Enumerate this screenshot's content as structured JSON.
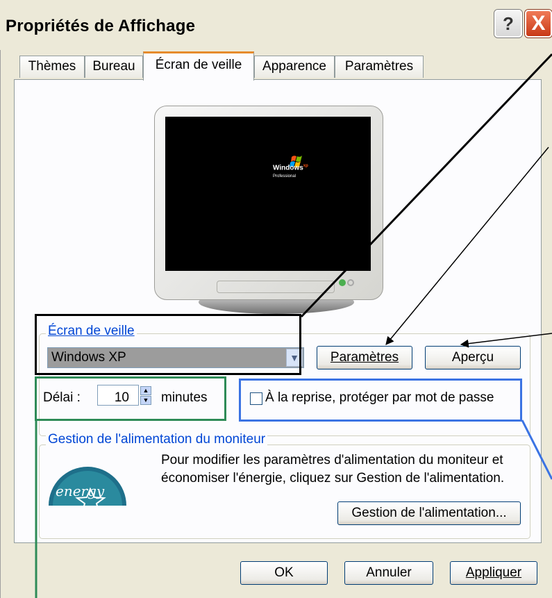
{
  "window": {
    "title": "Propriétés de Affichage",
    "help_symbol": "?",
    "close_symbol": "X"
  },
  "tabs": [
    {
      "label": "Thèmes"
    },
    {
      "label": "Bureau"
    },
    {
      "label": "Écran de veille",
      "active": true
    },
    {
      "label": "Apparence"
    },
    {
      "label": "Paramètres"
    }
  ],
  "preview": {
    "logo_text": "Windows",
    "logo_superscript": "xp",
    "logo_subtext": "Professional"
  },
  "screensaver": {
    "legend": "Écran de veille",
    "selected": "Windows XP",
    "settings_button": "Paramètres",
    "preview_button": "Aperçu",
    "delay_label": "Délai :",
    "delay_value": "10",
    "delay_unit": "minutes",
    "password_label": "À la reprise, protéger par mot de passe",
    "password_checked": false
  },
  "power": {
    "legend": "Gestion de l'alimentation du moniteur",
    "desc_line1": "Pour modifier les paramètres d'alimentation du moniteur et",
    "desc_line2": "économiser l'énergie, cliquez sur Gestion de l'alimentation.",
    "button": "Gestion de l'alimentation...",
    "logo_text": "energy"
  },
  "footer": {
    "ok": "OK",
    "cancel": "Annuler",
    "apply": "Appliquer"
  },
  "colors": {
    "dialog_bg": "#ece9d8",
    "panel_bg": "#fcfcfe",
    "legend_text": "#0046d5",
    "active_tab_accent": "#e68b2c",
    "annotation_black": "#000000",
    "annotation_green": "#2e8b57",
    "annotation_blue": "#3b73e3"
  }
}
